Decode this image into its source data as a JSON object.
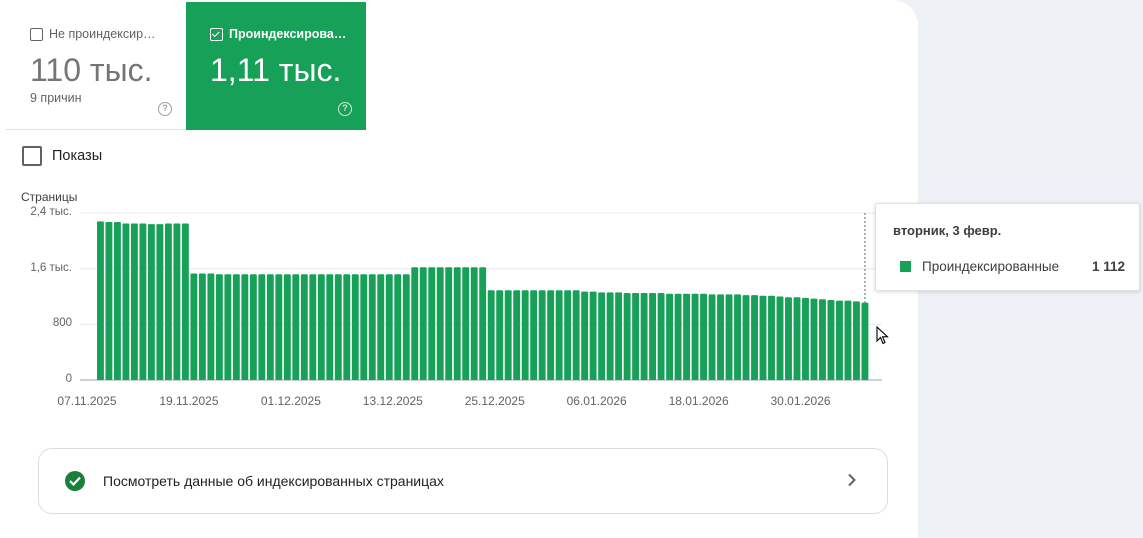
{
  "tiles": {
    "not_indexed": {
      "label": "Не проиндексир…",
      "value": "110 тыс.",
      "sub": "9 причин",
      "checked": false
    },
    "indexed": {
      "label": "Проиндексирова…",
      "value": "1,11 тыс.",
      "checked": true
    }
  },
  "impressions": {
    "label": "Показы",
    "checked": false
  },
  "tooltip": {
    "date": "вторник, 3 февр.",
    "series": "Проиндексированные",
    "value": "1 112"
  },
  "link": {
    "label": "Посмотреть данные об индексированных страницах"
  },
  "colors": {
    "accent": "#17a058",
    "check": "#188038"
  },
  "chart_data": {
    "type": "bar",
    "ylabel": "Страницы",
    "ylim": [
      0,
      2400
    ],
    "yticks": [
      {
        "value": 0,
        "label": "0"
      },
      {
        "value": 800,
        "label": "800"
      },
      {
        "value": 1600,
        "label": "1,6 тыс."
      },
      {
        "value": 2400,
        "label": "2,4 тыс."
      }
    ],
    "xtick_labels": [
      "07.11.2025",
      "19.11.2025",
      "01.12.2025",
      "13.12.2025",
      "25.12.2025",
      "06.01.2026",
      "18.01.2026",
      "30.01.2026"
    ],
    "xtick_indices": [
      0,
      12,
      24,
      36,
      48,
      60,
      72,
      84
    ],
    "series": [
      {
        "name": "Проиндексированные",
        "color": "#17a058",
        "values": [
          2280,
          2270,
          2270,
          2250,
          2250,
          2250,
          2240,
          2240,
          2250,
          2250,
          2250,
          1530,
          1530,
          1530,
          1520,
          1520,
          1520,
          1520,
          1520,
          1520,
          1520,
          1520,
          1520,
          1520,
          1520,
          1520,
          1520,
          1520,
          1520,
          1520,
          1520,
          1520,
          1520,
          1520,
          1520,
          1520,
          1520,
          1620,
          1620,
          1620,
          1620,
          1620,
          1620,
          1620,
          1620,
          1620,
          1290,
          1290,
          1290,
          1290,
          1290,
          1290,
          1290,
          1290,
          1290,
          1290,
          1290,
          1270,
          1270,
          1260,
          1260,
          1260,
          1250,
          1250,
          1250,
          1250,
          1250,
          1240,
          1240,
          1240,
          1240,
          1240,
          1230,
          1230,
          1230,
          1230,
          1220,
          1220,
          1210,
          1210,
          1200,
          1190,
          1190,
          1180,
          1170,
          1160,
          1150,
          1140,
          1140,
          1130,
          1112
        ]
      }
    ]
  }
}
